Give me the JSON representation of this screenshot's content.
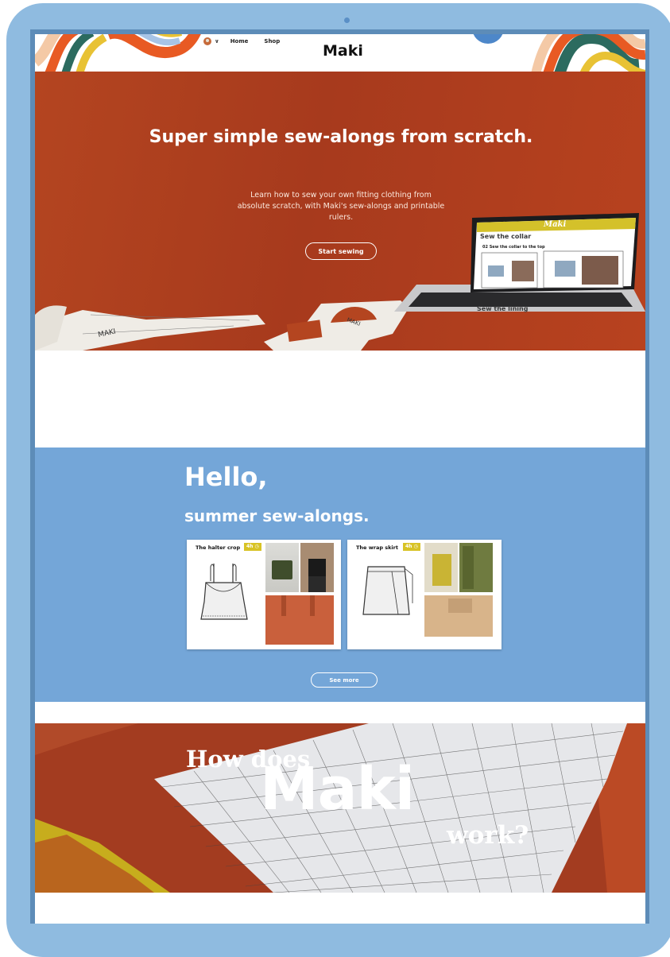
{
  "header": {
    "logo": "Maki",
    "nav_home": "Home",
    "nav_shop": "Shop",
    "language_chevron": "∨"
  },
  "hero": {
    "title": "Super simple sew-alongs from scratch.",
    "subtitle": "Learn how to sew your own fitting clothing from absolute scratch, with Maki's sew-alongs and printable rulers.",
    "cta": "Start sewing",
    "laptop_brand": "Maki",
    "laptop_heading1": "Sew the collar",
    "laptop_step": "02 Sew the collar to the top",
    "laptop_heading2": "Sew the lining"
  },
  "summer": {
    "hello": "Hello,",
    "heading": "summer sew-alongs.",
    "cards": [
      {
        "title": "The halter crop",
        "duration": "4h"
      },
      {
        "title": "The wrap skirt",
        "duration": "4h"
      }
    ],
    "see_more": "See more"
  },
  "how": {
    "line1": "How does",
    "line2": "Maki",
    "line3": "work?"
  },
  "colors": {
    "frame": "#8fbbe0",
    "hero_bg": "#a73a1d",
    "section_blue": "#74a6d8",
    "badge_yellow": "#d8c325",
    "laptop_bar": "#d4c12a"
  }
}
